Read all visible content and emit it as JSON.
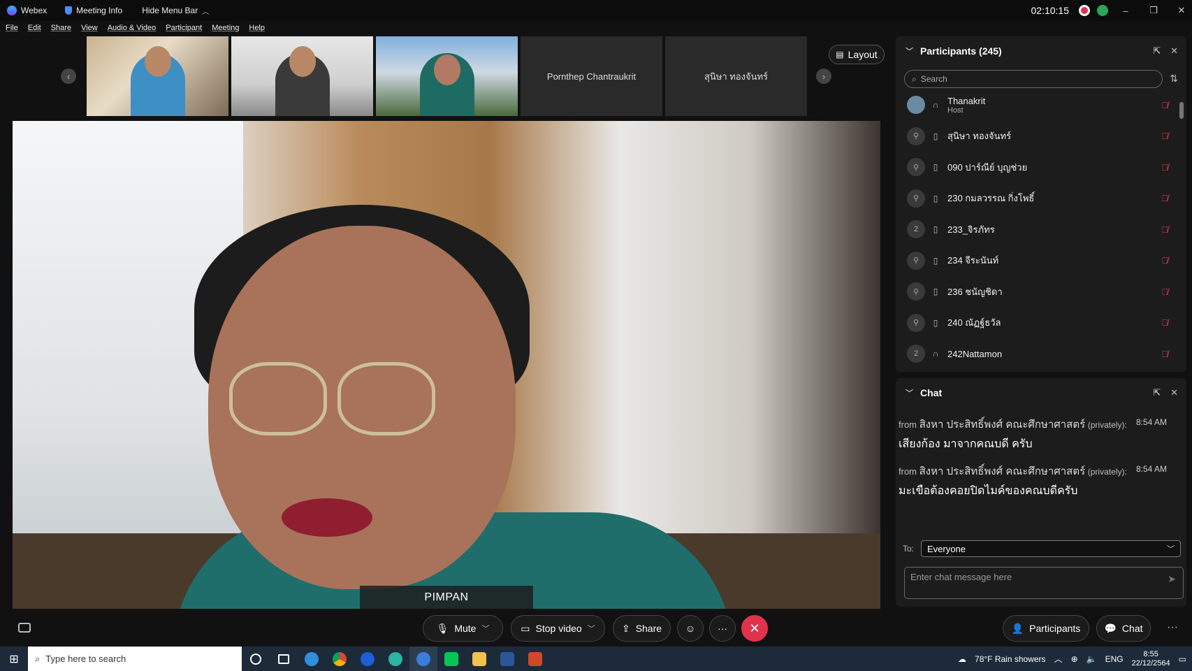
{
  "titlebar": {
    "app_name": "Webex",
    "meeting_info": "Meeting Info",
    "hide_menu": "Hide Menu Bar",
    "clock": "02:10:15"
  },
  "menu": [
    "File",
    "Edit",
    "Share",
    "View",
    "Audio & Video",
    "Participant",
    "Meeting",
    "Help"
  ],
  "thumbnails": {
    "names": [
      "Pornthep Chantraukrit",
      "สุนิษา ทองจันทร์"
    ],
    "layout_label": "Layout"
  },
  "main_video": {
    "speaker_name": "PIMPAN"
  },
  "participants": {
    "title": "Participants (245)",
    "search_placeholder": "Search",
    "list": [
      {
        "name": "Thanakrit",
        "role": "Host",
        "avatar": "",
        "device": "headset"
      },
      {
        "name": "สุนิษา ทองจันทร์",
        "role": "",
        "avatar": "",
        "device": "phone"
      },
      {
        "name": "090 ปาร์ณีย์ บุญช่วย",
        "role": "",
        "avatar": "",
        "device": "phone"
      },
      {
        "name": "230 กมลวรรณ กิ่งโพธิ์",
        "role": "",
        "avatar": "",
        "device": "phone"
      },
      {
        "name": "233_จิรภัทร",
        "role": "",
        "avatar": "2",
        "device": "phone"
      },
      {
        "name": "234 จีระนันท์",
        "role": "",
        "avatar": "",
        "device": "phone"
      },
      {
        "name": "236 ชนัญชิดา",
        "role": "",
        "avatar": "",
        "device": "phone"
      },
      {
        "name": "240 ณัฏฐ์ธวัล",
        "role": "",
        "avatar": "",
        "device": "phone"
      },
      {
        "name": "242Nattamon",
        "role": "",
        "avatar": "2",
        "device": "headset"
      }
    ]
  },
  "chat": {
    "title": "Chat",
    "messages": [
      {
        "from": "from",
        "sender": "สิงหา ประสิทธิ์พงศ์ คณะศึกษาศาสตร์",
        "privately": "(privately):",
        "time": "8:54 AM",
        "text": "เสียงก้อง มาจากคณบดี ครับ"
      },
      {
        "from": "from",
        "sender": "สิงหา ประสิทธิ์พงศ์ คณะศึกษาศาสตร์",
        "privately": "(privately):",
        "time": "8:54 AM",
        "text": "มะเขือต้องคอยปิดไมค์ของคณบดีครับ"
      }
    ],
    "to_label": "To:",
    "to_value": "Everyone",
    "input_placeholder": "Enter chat message here"
  },
  "controls": {
    "mute": "Mute",
    "stop_video": "Stop video",
    "share": "Share",
    "participants": "Participants",
    "chat": "Chat"
  },
  "taskbar": {
    "search_placeholder": "Type here to search",
    "weather": "78°F  Rain showers",
    "language": "ENG",
    "time": "8:55",
    "date": "22/12/2564"
  },
  "colors": {
    "end_call": "#e0334b",
    "muted_icon": "#e0425a",
    "panel_bg": "#1c1c1c"
  }
}
